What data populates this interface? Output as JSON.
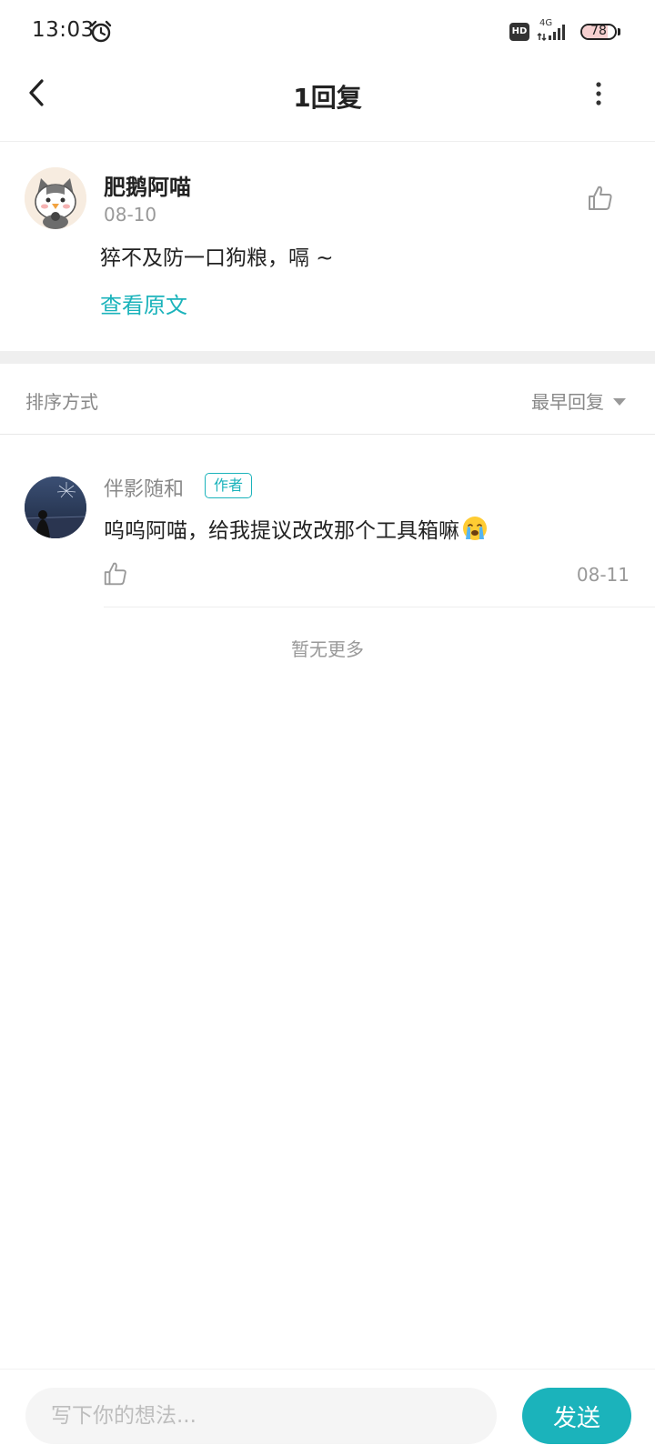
{
  "status_bar": {
    "time": "13:03",
    "hd_badge": "HD",
    "network": "4G",
    "battery": "78",
    "battery_level": 0.78
  },
  "header": {
    "title": "1回复"
  },
  "original_comment": {
    "user_name": "肥鹅阿喵",
    "date": "08-10",
    "text": "猝不及防一口狗粮，嗝 ~",
    "view_original_label": "查看原文"
  },
  "sort": {
    "label": "排序方式",
    "selected": "最早回复"
  },
  "reply": {
    "user_name": "伴影随和",
    "badge": "作者",
    "text": "呜呜阿喵，给我提议改改那个工具箱嘛",
    "date": "08-11"
  },
  "list_footer": {
    "no_more_text": "暂无更多"
  },
  "composer": {
    "placeholder": "写下你的想法...",
    "send_label": "发送"
  },
  "colors": {
    "accent": "#1bb3bb",
    "secondary_text": "#999999"
  }
}
